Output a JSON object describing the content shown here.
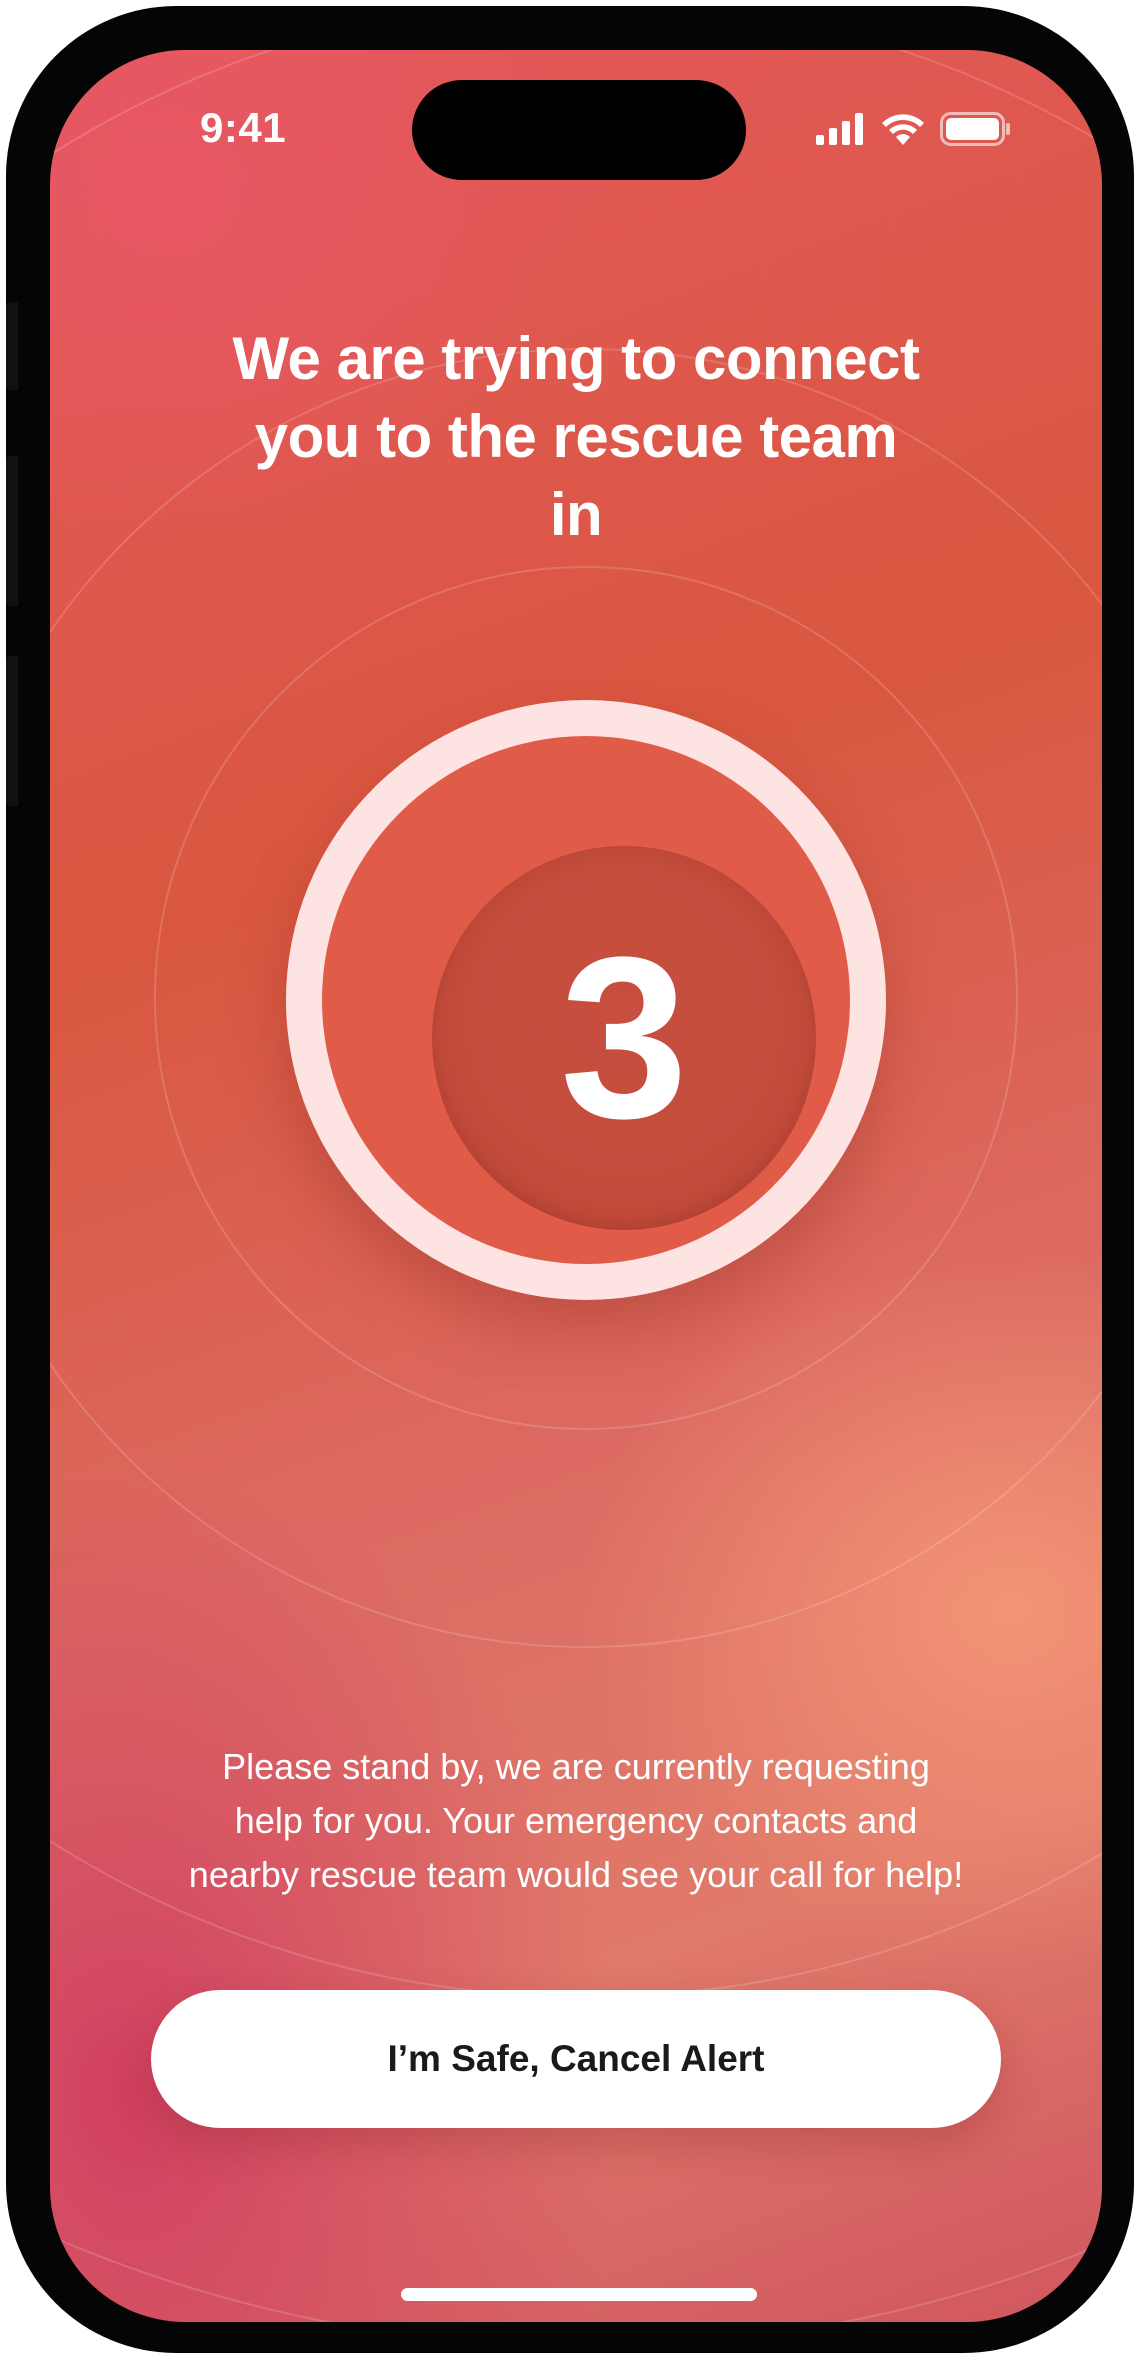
{
  "status_bar": {
    "time": "9:41",
    "icons": [
      "cellular-signal-icon",
      "wifi-icon",
      "battery-icon"
    ]
  },
  "headline": {
    "line1": "We are trying to connect",
    "line2": "you to the rescue team",
    "line3": "in"
  },
  "countdown": {
    "value": "3"
  },
  "message": {
    "line1": "Please stand by, we are currently requesting",
    "line2": "help for you. Your emergency contacts and",
    "line3": "nearby rescue team would see your call for help!"
  },
  "cancel_button": {
    "label": "I’m Safe, Cancel Alert"
  },
  "colors": {
    "background_primary": "#d9573f",
    "background_accent": "#f4967a",
    "counter_ring": "#fde4e2",
    "counter_middle": "#e05b48",
    "counter_core": "#c14b3a",
    "button_background": "#ffffff",
    "button_text": "#1a1a1a"
  }
}
